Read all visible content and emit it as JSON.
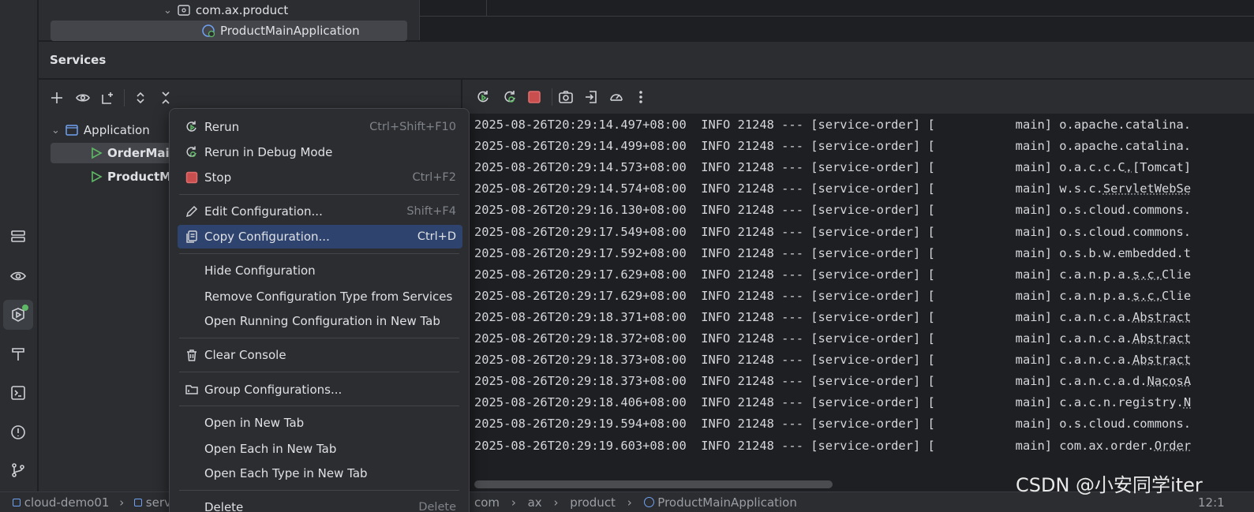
{
  "project_tree": {
    "package": "com.ax.product",
    "selected_class": "ProductMainApplication"
  },
  "services": {
    "title": "Services",
    "tree": {
      "group": "Application",
      "items": [
        "OrderMain",
        "ProductMa"
      ]
    }
  },
  "context_menu": {
    "items": [
      {
        "label": "Rerun",
        "shortcut": "Ctrl+Shift+F10",
        "icon": "rerun-icon"
      },
      {
        "label": "Rerun in Debug Mode",
        "shortcut": "",
        "icon": "rerun-debug-icon"
      },
      {
        "label": "Stop",
        "shortcut": "Ctrl+F2",
        "icon": "stop-icon"
      },
      {
        "label": "Edit Configuration...",
        "shortcut": "Shift+F4",
        "icon": "edit-icon"
      },
      {
        "label": "Copy Configuration...",
        "shortcut": "Ctrl+D",
        "icon": "copy-icon"
      },
      {
        "label": "Hide Configuration",
        "shortcut": "",
        "icon": ""
      },
      {
        "label": "Remove Configuration Type from Services",
        "shortcut": "",
        "icon": ""
      },
      {
        "label": "Open Running Configuration in New Tab",
        "shortcut": "",
        "icon": ""
      },
      {
        "label": "Clear Console",
        "shortcut": "",
        "icon": "trash-icon"
      },
      {
        "label": "Group Configurations...",
        "shortcut": "",
        "icon": "folder-icon"
      },
      {
        "label": "Open in New Tab",
        "shortcut": "",
        "icon": ""
      },
      {
        "label": "Open Each in New Tab",
        "shortcut": "",
        "icon": ""
      },
      {
        "label": "Open Each Type in New Tab",
        "shortcut": "",
        "icon": ""
      },
      {
        "label": "Delete",
        "shortcut": "Delete",
        "icon": ""
      }
    ],
    "highlighted_index": 4
  },
  "console": {
    "lines": [
      {
        "ts": "2025-08-26T20:29:14.497+08:00",
        "level": "INFO",
        "pid": "21248",
        "app": "[service-order]",
        "thread": "main",
        "logger": "o.apache.catalina."
      },
      {
        "ts": "2025-08-26T20:29:14.499+08:00",
        "level": "INFO",
        "pid": "21248",
        "app": "[service-order]",
        "thread": "main",
        "logger": "o.apache.catalina."
      },
      {
        "ts": "2025-08-26T20:29:14.573+08:00",
        "level": "INFO",
        "pid": "21248",
        "app": "[service-order]",
        "thread": "main",
        "logger": "o.a.c.c.C.[Tomcat]"
      },
      {
        "ts": "2025-08-26T20:29:14.574+08:00",
        "level": "INFO",
        "pid": "21248",
        "app": "[service-order]",
        "thread": "main",
        "logger": "w.s.c.ServletWebSe"
      },
      {
        "ts": "2025-08-26T20:29:16.130+08:00",
        "level": "INFO",
        "pid": "21248",
        "app": "[service-order]",
        "thread": "main",
        "logger": "o.s.cloud.commons."
      },
      {
        "ts": "2025-08-26T20:29:17.549+08:00",
        "level": "INFO",
        "pid": "21248",
        "app": "[service-order]",
        "thread": "main",
        "logger": "o.s.cloud.commons."
      },
      {
        "ts": "2025-08-26T20:29:17.592+08:00",
        "level": "INFO",
        "pid": "21248",
        "app": "[service-order]",
        "thread": "main",
        "logger": "o.s.b.w.embedded.t"
      },
      {
        "ts": "2025-08-26T20:29:17.629+08:00",
        "level": "INFO",
        "pid": "21248",
        "app": "[service-order]",
        "thread": "main",
        "logger": "c.a.n.p.a.s.c.Clie"
      },
      {
        "ts": "2025-08-26T20:29:17.629+08:00",
        "level": "INFO",
        "pid": "21248",
        "app": "[service-order]",
        "thread": "main",
        "logger": "c.a.n.p.a.s.c.Clie"
      },
      {
        "ts": "2025-08-26T20:29:18.371+08:00",
        "level": "INFO",
        "pid": "21248",
        "app": "[service-order]",
        "thread": "main",
        "logger": "c.a.n.c.a.Abstract"
      },
      {
        "ts": "2025-08-26T20:29:18.372+08:00",
        "level": "INFO",
        "pid": "21248",
        "app": "[service-order]",
        "thread": "main",
        "logger": "c.a.n.c.a.Abstract"
      },
      {
        "ts": "2025-08-26T20:29:18.373+08:00",
        "level": "INFO",
        "pid": "21248",
        "app": "[service-order]",
        "thread": "main",
        "logger": "c.a.n.c.a.Abstract"
      },
      {
        "ts": "2025-08-26T20:29:18.373+08:00",
        "level": "INFO",
        "pid": "21248",
        "app": "[service-order]",
        "thread": "main",
        "logger": "c.a.n.c.a.d.NacosA"
      },
      {
        "ts": "2025-08-26T20:29:18.406+08:00",
        "level": "INFO",
        "pid": "21248",
        "app": "[service-order]",
        "thread": "main",
        "logger": "c.a.c.n.registry.N"
      },
      {
        "ts": "2025-08-26T20:29:19.594+08:00",
        "level": "INFO",
        "pid": "21248",
        "app": "[service-order]",
        "thread": "main",
        "logger": "o.s.cloud.commons."
      },
      {
        "ts": "2025-08-26T20:29:19.603+08:00",
        "level": "INFO",
        "pid": "21248",
        "app": "[service-order]",
        "thread": "main",
        "logger": "com.ax.order.Order"
      }
    ]
  },
  "statusbar": {
    "left_crumbs": [
      "cloud-demo01",
      "servi"
    ],
    "right_crumbs": [
      "com",
      "ax",
      "product",
      "ProductMainApplication"
    ],
    "position": "12:1"
  },
  "watermark": "CSDN @小安同学iter",
  "colors": {
    "accent": "#2e436e",
    "stop": "#c94f4f",
    "run": "#5fb865"
  }
}
